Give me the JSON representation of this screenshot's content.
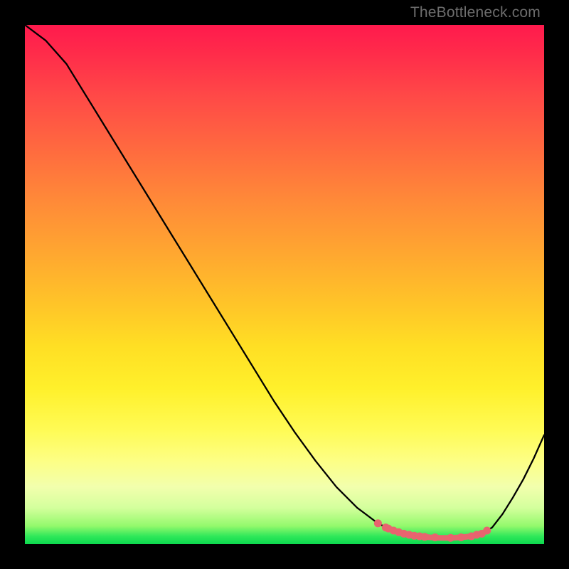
{
  "watermark": "TheBottleneck.com",
  "colors": {
    "watermark": "#6d6d6d",
    "curve": "#000000",
    "dots": "#e8646f",
    "valley_stroke": "#e8646f"
  },
  "chart_data": {
    "type": "line",
    "title": "",
    "xlabel": "",
    "ylabel": "",
    "xlim": [
      0,
      100
    ],
    "ylim": [
      0,
      100
    ],
    "x": [
      0,
      4,
      8,
      12,
      16,
      20,
      24,
      28,
      32,
      36,
      40,
      44,
      48,
      52,
      56,
      60,
      64,
      68,
      70,
      72,
      73,
      74,
      76,
      78,
      80,
      82,
      84,
      86,
      88,
      90,
      92,
      94,
      96,
      98,
      100
    ],
    "values": [
      100,
      97,
      92.5,
      86,
      79.5,
      73,
      66.5,
      60,
      53.5,
      47,
      40.5,
      34,
      27.5,
      21.5,
      16,
      11,
      7,
      4,
      3,
      2.3,
      2,
      1.8,
      1.5,
      1.3,
      1.2,
      1.2,
      1.3,
      1.5,
      2,
      3.2,
      5.8,
      9,
      12.5,
      16.5,
      21
    ],
    "highlight_dots_x": [
      68,
      69.5,
      70,
      71,
      72,
      73,
      74,
      75,
      76,
      77,
      79,
      82,
      84,
      86,
      87,
      88,
      89
    ],
    "highlight_dots_y": [
      4,
      3.2,
      3,
      2.6,
      2.3,
      2,
      1.8,
      1.6,
      1.5,
      1.4,
      1.3,
      1.2,
      1.3,
      1.5,
      1.8,
      2,
      2.6
    ],
    "valley_range_x": [
      70,
      88
    ]
  }
}
